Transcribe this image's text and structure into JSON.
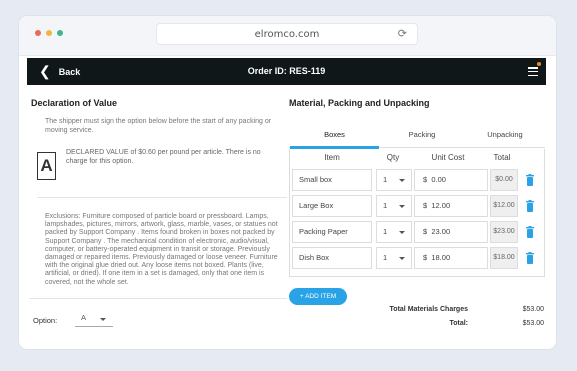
{
  "browser": {
    "url": "elromco.com",
    "dot_colors": [
      "#e86a5a",
      "#f0b542",
      "#3fb68b"
    ]
  },
  "appbar": {
    "back_label": "Back",
    "order_title": "Order ID: RES-119",
    "menu_icon": "hamburger-menu-icon",
    "notification_color": "#f08a24"
  },
  "declaration": {
    "title": "Declaration of Value",
    "intro": "The shipper must sign the option below before the start of any packing or moving service.",
    "option_letter": "A",
    "declared_text": "DECLARED VALUE of $0.60 per pound per article. There is no charge for this option.",
    "exclusions": "Exclusions: Furniture composed of particle board or pressboard. Lamps, lampshades, pictures, mirrors, artwork, glass, marble, vases, or statues not packed by Support Company . Items found broken in boxes not packed by Support Company . The mechanical condition of electronic, audio/visual, computer, or battery-operated equipment in transit or storage. Previously damaged or repaired items. Previously damaged or loose veneer. Furniture with the original glue dried out. Any loose items not boxed. Plants (live, artificial, or dried). If one item in a set is damaged, only that one item is covered, not the whole set.",
    "option_label": "Option:",
    "option_value": "A"
  },
  "materials": {
    "title": "Material, Packing and Unpacking",
    "tabs": [
      {
        "label": "Boxes",
        "active": true
      },
      {
        "label": "Packing",
        "active": false
      },
      {
        "label": "Unpacking",
        "active": false
      }
    ],
    "columns": {
      "item": "Item",
      "qty": "Qty",
      "unit_cost": "Unit Cost",
      "total": "Total"
    },
    "rows": [
      {
        "item": "Small box",
        "qty": "1",
        "currency": "$",
        "unit_cost": "0.00",
        "total": "$0.00"
      },
      {
        "item": "Large Box",
        "qty": "1",
        "currency": "$",
        "unit_cost": "12.00",
        "total": "$12.00"
      },
      {
        "item": "Packing Paper",
        "qty": "1",
        "currency": "$",
        "unit_cost": "23.00",
        "total": "$23.00"
      },
      {
        "item": "Dish Box",
        "qty": "1",
        "currency": "$",
        "unit_cost": "18.00",
        "total": "$18.00"
      }
    ],
    "add_item_label": "+ ADD ITEM",
    "total_materials_label": "Total Materials Charges",
    "total_materials_value": "$53.00",
    "total_label": "Total:",
    "total_value": "$53.00",
    "accent_color": "#2aa3e6",
    "icons": {
      "delete": "trash-icon",
      "qty_dropdown": "chevron-down-icon"
    }
  }
}
